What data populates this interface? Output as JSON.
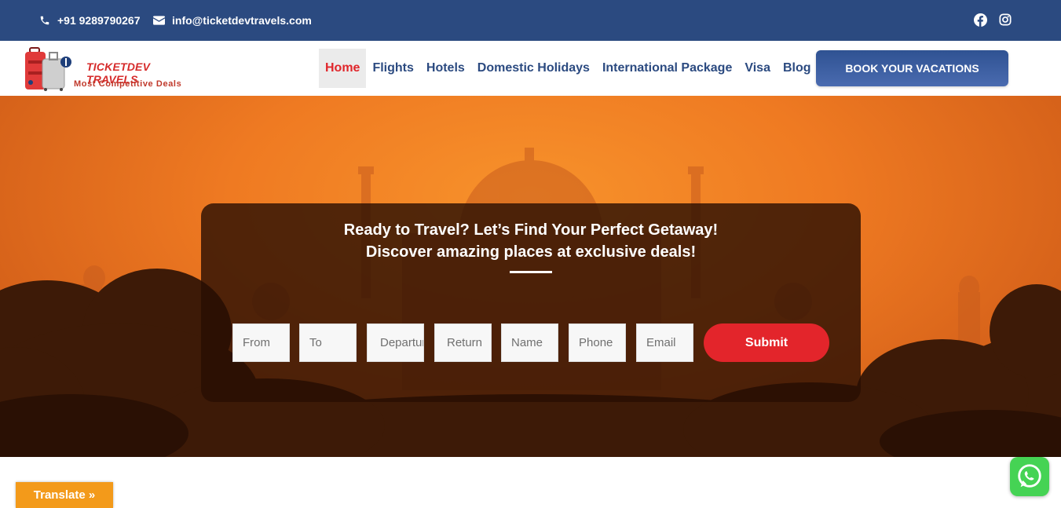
{
  "topbar": {
    "phone": "+91 9289790267",
    "email": "info@ticketdevtravels.com",
    "social_icons": [
      "facebook-icon",
      "instagram-icon"
    ]
  },
  "header": {
    "logo": {
      "brand": "TICKETDEV TRAVELS",
      "tagline": "Most Competitive Deals"
    },
    "nav": [
      {
        "label": "Home",
        "active": true
      },
      {
        "label": "Flights"
      },
      {
        "label": "Hotels"
      },
      {
        "label": "Domestic Holidays"
      },
      {
        "label": "International Package"
      },
      {
        "label": "Visa"
      },
      {
        "label": "Blog"
      }
    ],
    "cta_label": "BOOK YOUR VACATIONS"
  },
  "hero": {
    "heading_line1": "Ready to Travel? Let’s Find Your Perfect Getaway!",
    "heading_line2": "Discover amazing places at exclusive deals!",
    "form": {
      "fields": [
        {
          "placeholder": "From"
        },
        {
          "placeholder": "To"
        },
        {
          "placeholder": "Departure"
        },
        {
          "placeholder": "Return"
        },
        {
          "placeholder": "Name"
        },
        {
          "placeholder": "Phone"
        },
        {
          "placeholder": "Email"
        }
      ],
      "submit_label": "Submit"
    }
  },
  "widgets": {
    "translate_label": "Translate »",
    "whatsapp_icon": "whatsapp-icon"
  },
  "colors": {
    "topbar": "#2b4a80",
    "nav_text": "#2b4a80",
    "active_nav": "#e0262b",
    "submit": "#e3252b",
    "translate": "#f39a1a",
    "whatsapp": "#45d354"
  }
}
